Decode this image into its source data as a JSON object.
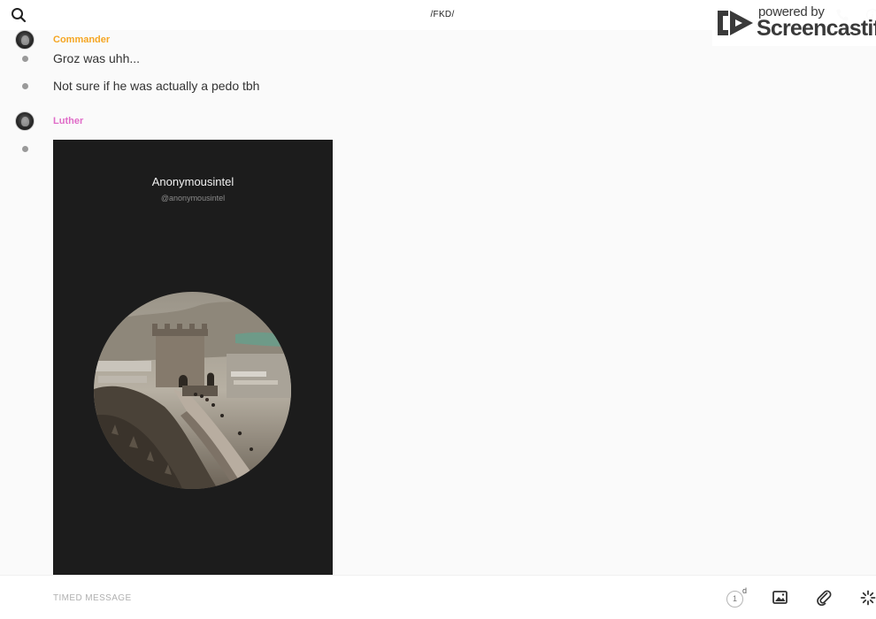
{
  "header": {
    "channel_title": "/FKD/"
  },
  "watermark": {
    "powered_by": "powered by",
    "brand": "Screencastify"
  },
  "messages": [
    {
      "username": "Commander",
      "username_color": "#f5a623",
      "lines": [
        "Groz was uhh...",
        "Not sure if he was actually a pedo tbh"
      ]
    },
    {
      "username": "Luther",
      "username_color": "#e06cc8",
      "attachment": {
        "type": "image",
        "title": "Anonymousintel",
        "handle": "@anonymousintel"
      }
    }
  ],
  "composer": {
    "placeholder": "TIMED MESSAGE",
    "timer_value": "1",
    "timer_unit": "d"
  },
  "icons": [
    "search-icon",
    "phone-icon",
    "info-icon",
    "screencastify-logo",
    "image-icon",
    "paperclip-icon",
    "spinner-icon"
  ],
  "colors": {
    "background": "#fafafa",
    "card_background": "#1c1c1c"
  }
}
